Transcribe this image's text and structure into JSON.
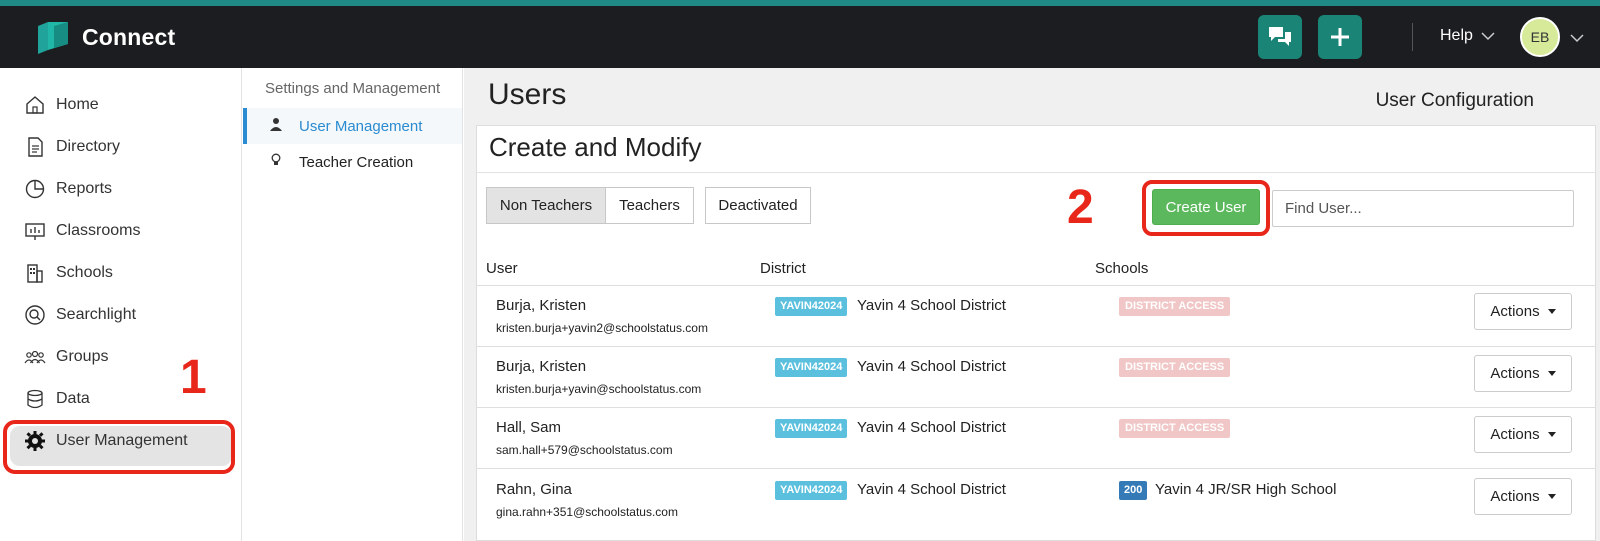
{
  "app": {
    "name": "Connect"
  },
  "topbar": {
    "help_label": "Help",
    "avatar_initials": "EB"
  },
  "sidebar": {
    "items": [
      {
        "label": "Home",
        "icon": "home-icon"
      },
      {
        "label": "Directory",
        "icon": "directory-icon"
      },
      {
        "label": "Reports",
        "icon": "reports-icon"
      },
      {
        "label": "Classrooms",
        "icon": "classrooms-icon"
      },
      {
        "label": "Schools",
        "icon": "schools-icon"
      },
      {
        "label": "Searchlight",
        "icon": "searchlight-icon"
      },
      {
        "label": "Groups",
        "icon": "groups-icon"
      },
      {
        "label": "Data",
        "icon": "data-icon"
      },
      {
        "label": "User Management",
        "icon": "gear-icon",
        "active": true
      }
    ]
  },
  "subnav": {
    "title": "Settings and Management",
    "items": [
      {
        "label": "User Management",
        "active": true
      },
      {
        "label": "Teacher Creation"
      }
    ]
  },
  "main": {
    "title": "Users",
    "config_label": "User Configuration",
    "panel_title": "Create and Modify",
    "tabs": [
      {
        "label": "Non Teachers",
        "active": true
      },
      {
        "label": "Teachers"
      },
      {
        "label": "Deactivated"
      }
    ],
    "create_button": "Create User",
    "search_placeholder": "Find User...",
    "columns": [
      "User",
      "District",
      "Schools"
    ],
    "rows": [
      {
        "name": "Burja, Kristen",
        "email": "kristen.burja+yavin2@schoolstatus.com",
        "district_code": "YAVIN42024",
        "district": "Yavin 4 School District",
        "school_badge": "DISTRICT ACCESS",
        "school": "",
        "action": "Actions"
      },
      {
        "name": "Burja, Kristen",
        "email": "kristen.burja+yavin@schoolstatus.com",
        "district_code": "YAVIN42024",
        "district": "Yavin 4 School District",
        "school_badge": "DISTRICT ACCESS",
        "school": "",
        "action": "Actions"
      },
      {
        "name": "Hall, Sam",
        "email": "sam.hall+579@schoolstatus.com",
        "district_code": "YAVIN42024",
        "district": "Yavin 4 School District",
        "school_badge": "DISTRICT ACCESS",
        "school": "",
        "action": "Actions"
      },
      {
        "name": "Rahn, Gina",
        "email": "gina.rahn+351@schoolstatus.com",
        "district_code": "YAVIN42024",
        "district": "Yavin 4 School District",
        "school_badge": "200",
        "school": "Yavin 4 JR/SR High School",
        "action": "Actions"
      }
    ]
  },
  "annotations": {
    "step1": "1",
    "step2": "2",
    "color": "#e8261a"
  },
  "colors": {
    "accent": "#1a8577",
    "primary_link": "#2a8bd0",
    "success": "#5cb85c",
    "info": "#5bc0de"
  }
}
